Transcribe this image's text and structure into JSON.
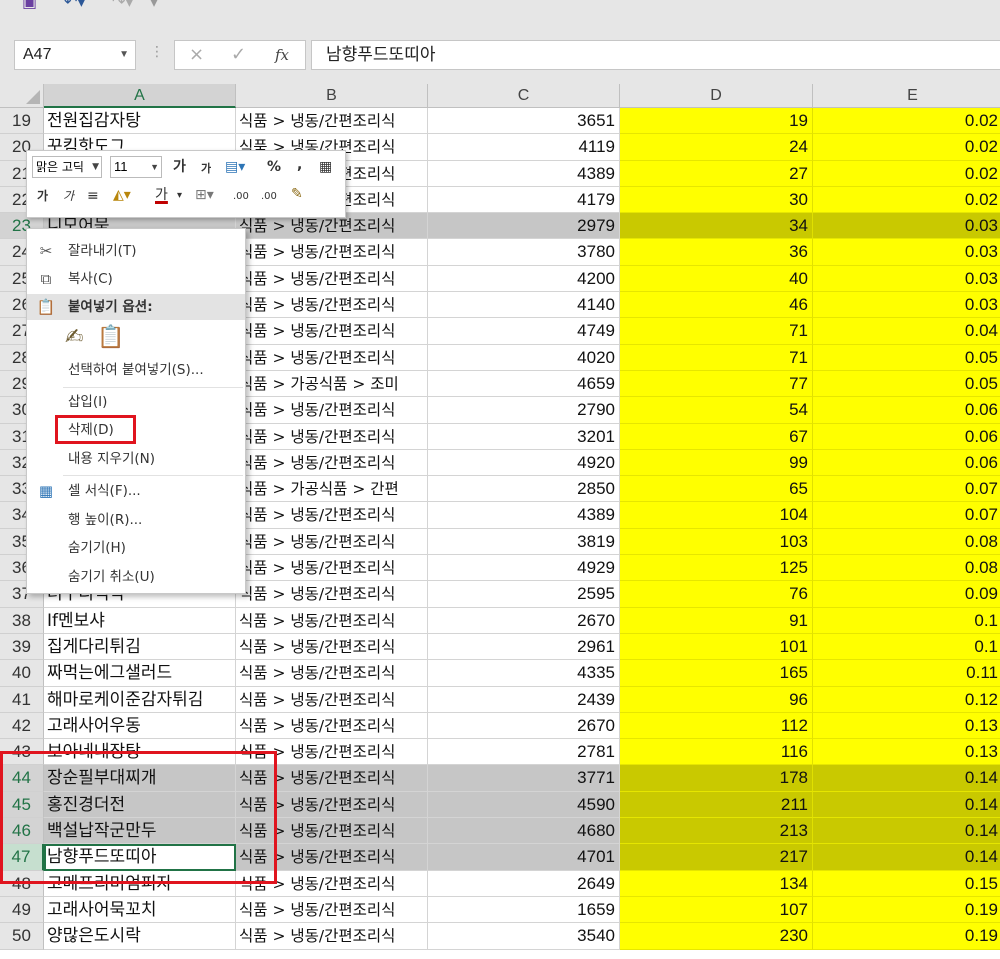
{
  "toolbar": {
    "save_icon": "save-icon",
    "undo_icon": "undo-icon",
    "redo_icon": "redo-icon"
  },
  "formula_bar": {
    "name_box": "A47",
    "cancel_glyph": "×",
    "enter_glyph": "✓",
    "fx_label": "fx",
    "content": "남향푸드또띠아"
  },
  "columns": [
    "A",
    "B",
    "C",
    "D",
    "E"
  ],
  "rows": [
    {
      "n": "19",
      "a": "전원집감자탕",
      "b": "식품 > 냉동/간편조리식",
      "c": "3651",
      "d": "19",
      "e": "0.02"
    },
    {
      "n": "20",
      "a": "꾸킴핫도그",
      "b": "식품 > 냉동/간편조리식",
      "c": "4119",
      "d": "24",
      "e": "0.02"
    },
    {
      "n": "21",
      "a": "",
      "b": "식품 > 냉동/간편조리식",
      "c": "4389",
      "d": "27",
      "e": "0.02"
    },
    {
      "n": "22",
      "a": "",
      "b": "식품 > 냉동/간편조리식",
      "c": "4179",
      "d": "30",
      "e": "0.02"
    },
    {
      "n": "23",
      "a": "니모어묵",
      "b": "식품 > 냉동/간편조리식",
      "c": "2979",
      "d": "34",
      "e": "0.03"
    },
    {
      "n": "24",
      "a": "",
      "b": "식품 > 냉동/간편조리식",
      "c": "3780",
      "d": "36",
      "e": "0.03"
    },
    {
      "n": "25",
      "a": "",
      "b": "식품 > 냉동/간편조리식",
      "c": "4200",
      "d": "40",
      "e": "0.03"
    },
    {
      "n": "26",
      "a": "",
      "b": "식품 > 냉동/간편조리식",
      "c": "4140",
      "d": "46",
      "e": "0.03"
    },
    {
      "n": "27",
      "a": "",
      "b": "식품 > 냉동/간편조리식",
      "c": "4749",
      "d": "71",
      "e": "0.04"
    },
    {
      "n": "28",
      "a": "",
      "b": "식품 > 냉동/간편조리식",
      "c": "4020",
      "d": "71",
      "e": "0.05"
    },
    {
      "n": "29",
      "a": "",
      "b": "식품 > 가공식품 > 조미",
      "c": "4659",
      "d": "77",
      "e": "0.05"
    },
    {
      "n": "30",
      "a": "",
      "b": "식품 > 냉동/간편조리식",
      "c": "2790",
      "d": "54",
      "e": "0.06"
    },
    {
      "n": "31",
      "a": "",
      "b": "식품 > 냉동/간편조리식",
      "c": "3201",
      "d": "67",
      "e": "0.06"
    },
    {
      "n": "32",
      "a": "",
      "b": "식품 > 냉동/간편조리식",
      "c": "4920",
      "d": "99",
      "e": "0.06"
    },
    {
      "n": "33",
      "a": "",
      "b": "식품 > 가공식품 > 간편",
      "c": "2850",
      "d": "65",
      "e": "0.07"
    },
    {
      "n": "34",
      "a": "",
      "b": "식품 > 냉동/간편조리식",
      "c": "4389",
      "d": "104",
      "e": "0.07"
    },
    {
      "n": "35",
      "a": "",
      "b": "식품 > 냉동/간편조리식",
      "c": "3819",
      "d": "103",
      "e": "0.08"
    },
    {
      "n": "36",
      "a": "",
      "b": "식품 > 냉동/간편조리식",
      "c": "4929",
      "d": "125",
      "e": "0.08"
    },
    {
      "n": "37",
      "a": "더꾸리식탁",
      "b": "식품 > 냉동/간편조리식",
      "c": "2595",
      "d": "76",
      "e": "0.09"
    },
    {
      "n": "38",
      "a": "If멘보샤",
      "b": "식품 > 냉동/간편조리식",
      "c": "2670",
      "d": "91",
      "e": "0.1"
    },
    {
      "n": "39",
      "a": "집게다리튀김",
      "b": "식품 > 냉동/간편조리식",
      "c": "2961",
      "d": "101",
      "e": "0.1"
    },
    {
      "n": "40",
      "a": "짜먹는에그샐러드",
      "b": "식품 > 냉동/간편조리식",
      "c": "4335",
      "d": "165",
      "e": "0.11"
    },
    {
      "n": "41",
      "a": "해마로케이준감자튀김",
      "b": "식품 > 냉동/간편조리식",
      "c": "2439",
      "d": "96",
      "e": "0.12"
    },
    {
      "n": "42",
      "a": "고래사어우동",
      "b": "식품 > 냉동/간편조리식",
      "c": "2670",
      "d": "112",
      "e": "0.13"
    },
    {
      "n": "43",
      "a": "보아네내장탕",
      "b": "식품 > 냉동/간편조리식",
      "c": "2781",
      "d": "116",
      "e": "0.13"
    },
    {
      "n": "44",
      "a": "장순필부대찌개",
      "b": "식품 > 냉동/간편조리식",
      "c": "3771",
      "d": "178",
      "e": "0.14"
    },
    {
      "n": "45",
      "a": "홍진경더전",
      "b": "식품 > 냉동/간편조리식",
      "c": "4590",
      "d": "211",
      "e": "0.14"
    },
    {
      "n": "46",
      "a": "백설납작군만두",
      "b": "식품 > 냉동/간편조리식",
      "c": "4680",
      "d": "213",
      "e": "0.14"
    },
    {
      "n": "47",
      "a": "남향푸드또띠아",
      "b": "식품 > 냉동/간편조리식",
      "c": "4701",
      "d": "217",
      "e": "0.14"
    },
    {
      "n": "48",
      "a": "고메프리미엄피자",
      "b": "식품 > 냉동/간편조리식",
      "c": "2649",
      "d": "134",
      "e": "0.15"
    },
    {
      "n": "49",
      "a": "고래사어묵꼬치",
      "b": "식품 > 냉동/간편조리식",
      "c": "1659",
      "d": "107",
      "e": "0.19"
    },
    {
      "n": "50",
      "a": "양많은도시락",
      "b": "식품 > 냉동/간편조리식",
      "c": "3540",
      "d": "230",
      "e": "0.19"
    }
  ],
  "selected_rows": [
    "23",
    "44",
    "45",
    "46",
    "47"
  ],
  "active_row": "47",
  "mini_toolbar": {
    "font_name": "맑은 고딕",
    "font_size": "11",
    "grow_font": "가",
    "shrink_font": "가",
    "percent": "%",
    "comma": ",",
    "bold": "가",
    "italic": "가",
    "font_color": "가",
    "dec_increase": ".00",
    "dec_decrease": ".00"
  },
  "context_menu": {
    "cut": "잘라내기(T)",
    "copy": "복사(C)",
    "paste_options": "붙여넣기 옵션:",
    "paste_special": "선택하여 붙여넣기(S)...",
    "insert": "삽입(I)",
    "delete": "삭제(D)",
    "clear_contents": "내용 지우기(N)",
    "format_cells": "셀 서식(F)...",
    "row_height": "행 높이(R)...",
    "hide": "숨기기(H)",
    "unhide": "숨기기 취소(U)"
  },
  "colors": {
    "accent": "#217346",
    "highlight_yellow": "#ffff00",
    "annotation_red": "#e0141e"
  }
}
